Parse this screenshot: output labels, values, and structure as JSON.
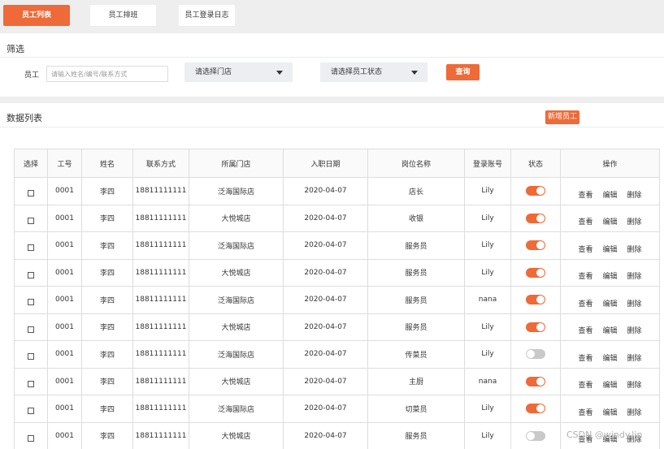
{
  "tabs": [
    {
      "label": "员工列表",
      "active": true
    },
    {
      "label": "员工排班",
      "active": false
    },
    {
      "label": "员工登录日志",
      "active": false
    }
  ],
  "filter": {
    "title": "筛选",
    "employee_label": "员工",
    "search_placeholder": "请输入姓名/编号/联系方式",
    "store_select": "请选择门店",
    "status_select": "请选择员工状态",
    "query_button": "查询"
  },
  "list": {
    "title": "数据列表",
    "add_button": "新增员工"
  },
  "table": {
    "headers": [
      "选择",
      "工号",
      "姓名",
      "联系方式",
      "所属门店",
      "入职日期",
      "岗位名称",
      "登录账号",
      "状态",
      "操作"
    ],
    "actions": {
      "view": "查看",
      "edit": "编辑",
      "delete": "删除"
    },
    "rows": [
      {
        "id": "0001",
        "name": "李四",
        "phone": "18811111111",
        "store": "泛海国际店",
        "date": "2020-04-07",
        "position": "店长",
        "account": "Lily",
        "enabled": true
      },
      {
        "id": "0001",
        "name": "李四",
        "phone": "18811111111",
        "store": "大悦城店",
        "date": "2020-04-07",
        "position": "收银",
        "account": "Lily",
        "enabled": true
      },
      {
        "id": "0001",
        "name": "李四",
        "phone": "18811111111",
        "store": "泛海国际店",
        "date": "2020-04-07",
        "position": "服务员",
        "account": "Lily",
        "enabled": true
      },
      {
        "id": "0001",
        "name": "李四",
        "phone": "18811111111",
        "store": "大悦城店",
        "date": "2020-04-07",
        "position": "服务员",
        "account": "Lily",
        "enabled": true
      },
      {
        "id": "0001",
        "name": "李四",
        "phone": "18811111111",
        "store": "泛海国际店",
        "date": "2020-04-07",
        "position": "服务员",
        "account": "nana",
        "enabled": true
      },
      {
        "id": "0001",
        "name": "李四",
        "phone": "18811111111",
        "store": "大悦城店",
        "date": "2020-04-07",
        "position": "服务员",
        "account": "Lily",
        "enabled": true
      },
      {
        "id": "0001",
        "name": "李四",
        "phone": "18811111111",
        "store": "泛海国际店",
        "date": "2020-04-07",
        "position": "传菜员",
        "account": "Lily",
        "enabled": false
      },
      {
        "id": "0001",
        "name": "李四",
        "phone": "18811111111",
        "store": "大悦城店",
        "date": "2020-04-07",
        "position": "主厨",
        "account": "nana",
        "enabled": true
      },
      {
        "id": "0001",
        "name": "李四",
        "phone": "18811111111",
        "store": "泛海国际店",
        "date": "2020-04-07",
        "position": "切菜员",
        "account": "Lily",
        "enabled": true
      },
      {
        "id": "0001",
        "name": "李四",
        "phone": "18811111111",
        "store": "大悦城店",
        "date": "2020-04-07",
        "position": "服务员",
        "account": "Lily",
        "enabled": false
      }
    ]
  },
  "watermark": "CSDN @windy.lin",
  "colors": {
    "accent": "#ee6a38",
    "toggle_off": "#c9c9c9"
  }
}
